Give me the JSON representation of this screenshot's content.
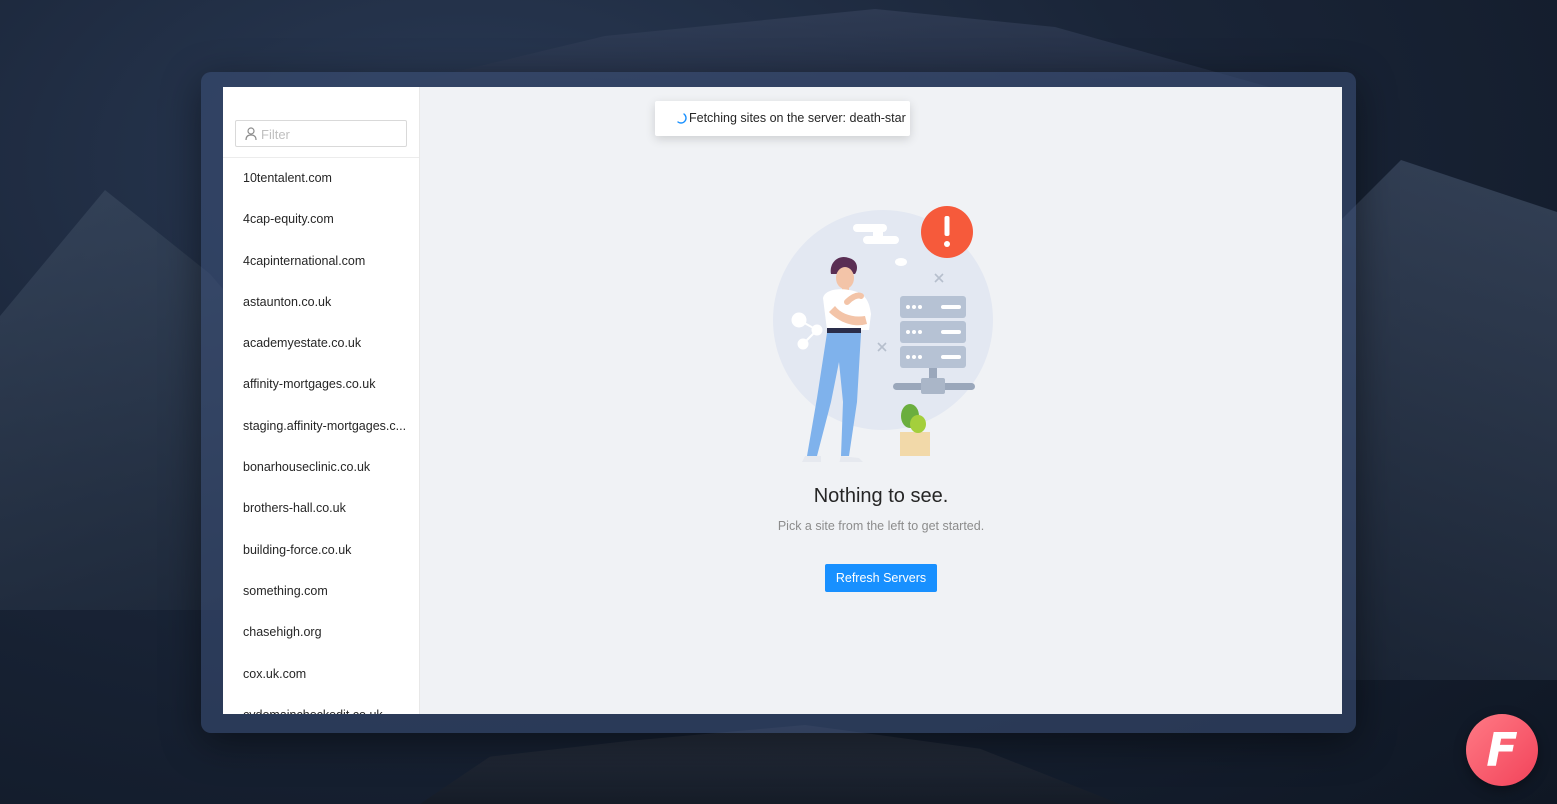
{
  "sidebar": {
    "filter_placeholder": "Filter",
    "sites": [
      "10tentalent.com",
      "4cap-equity.com",
      "4capinternational.com",
      "astaunton.co.uk",
      "academyestate.co.uk",
      "affinity-mortgages.co.uk",
      "staging.affinity-mortgages.c...",
      "bonarhouseclinic.co.uk",
      "brothers-hall.co.uk",
      "building-force.co.uk",
      "something.com",
      "chasehigh.org",
      "cox.uk.com",
      "cydomaincheckedit.co.uk"
    ]
  },
  "toast": {
    "message": "Fetching sites on the server: death-star"
  },
  "empty_state": {
    "title": "Nothing to see.",
    "subtitle": "Pick a site from the left to get started.",
    "button_label": "Refresh Servers"
  },
  "logo": {
    "letter": "F"
  },
  "colors": {
    "primary": "#1890ff",
    "alert": "#f65a3b",
    "logo_gradient_start": "#ff7a85",
    "logo_gradient_end": "#f2435a"
  }
}
